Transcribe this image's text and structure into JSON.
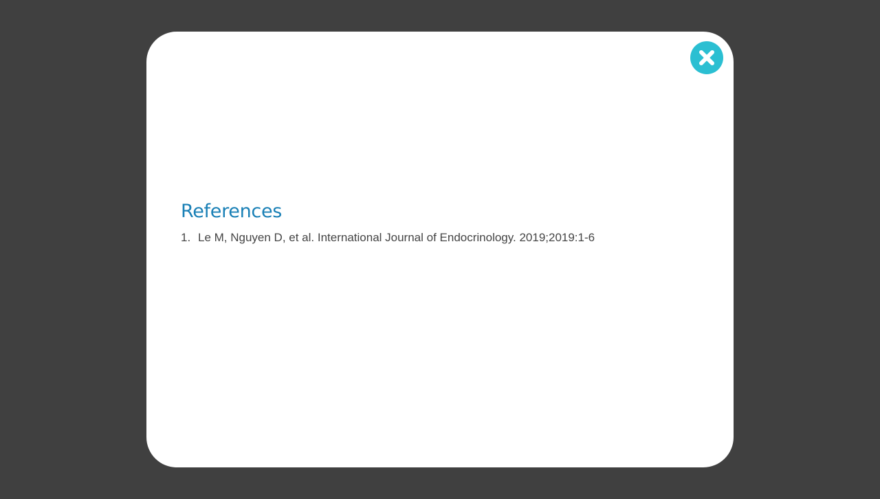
{
  "modal": {
    "close_icon": "close-x-icon",
    "accent_color": "#2bbfd2",
    "heading": "References",
    "heading_color": "#1a80b6",
    "references": [
      {
        "number": "1.",
        "text": "Le M, Nguyen D, et al. International Journal of Endocrinology. 2019;2019:1-6"
      }
    ]
  }
}
